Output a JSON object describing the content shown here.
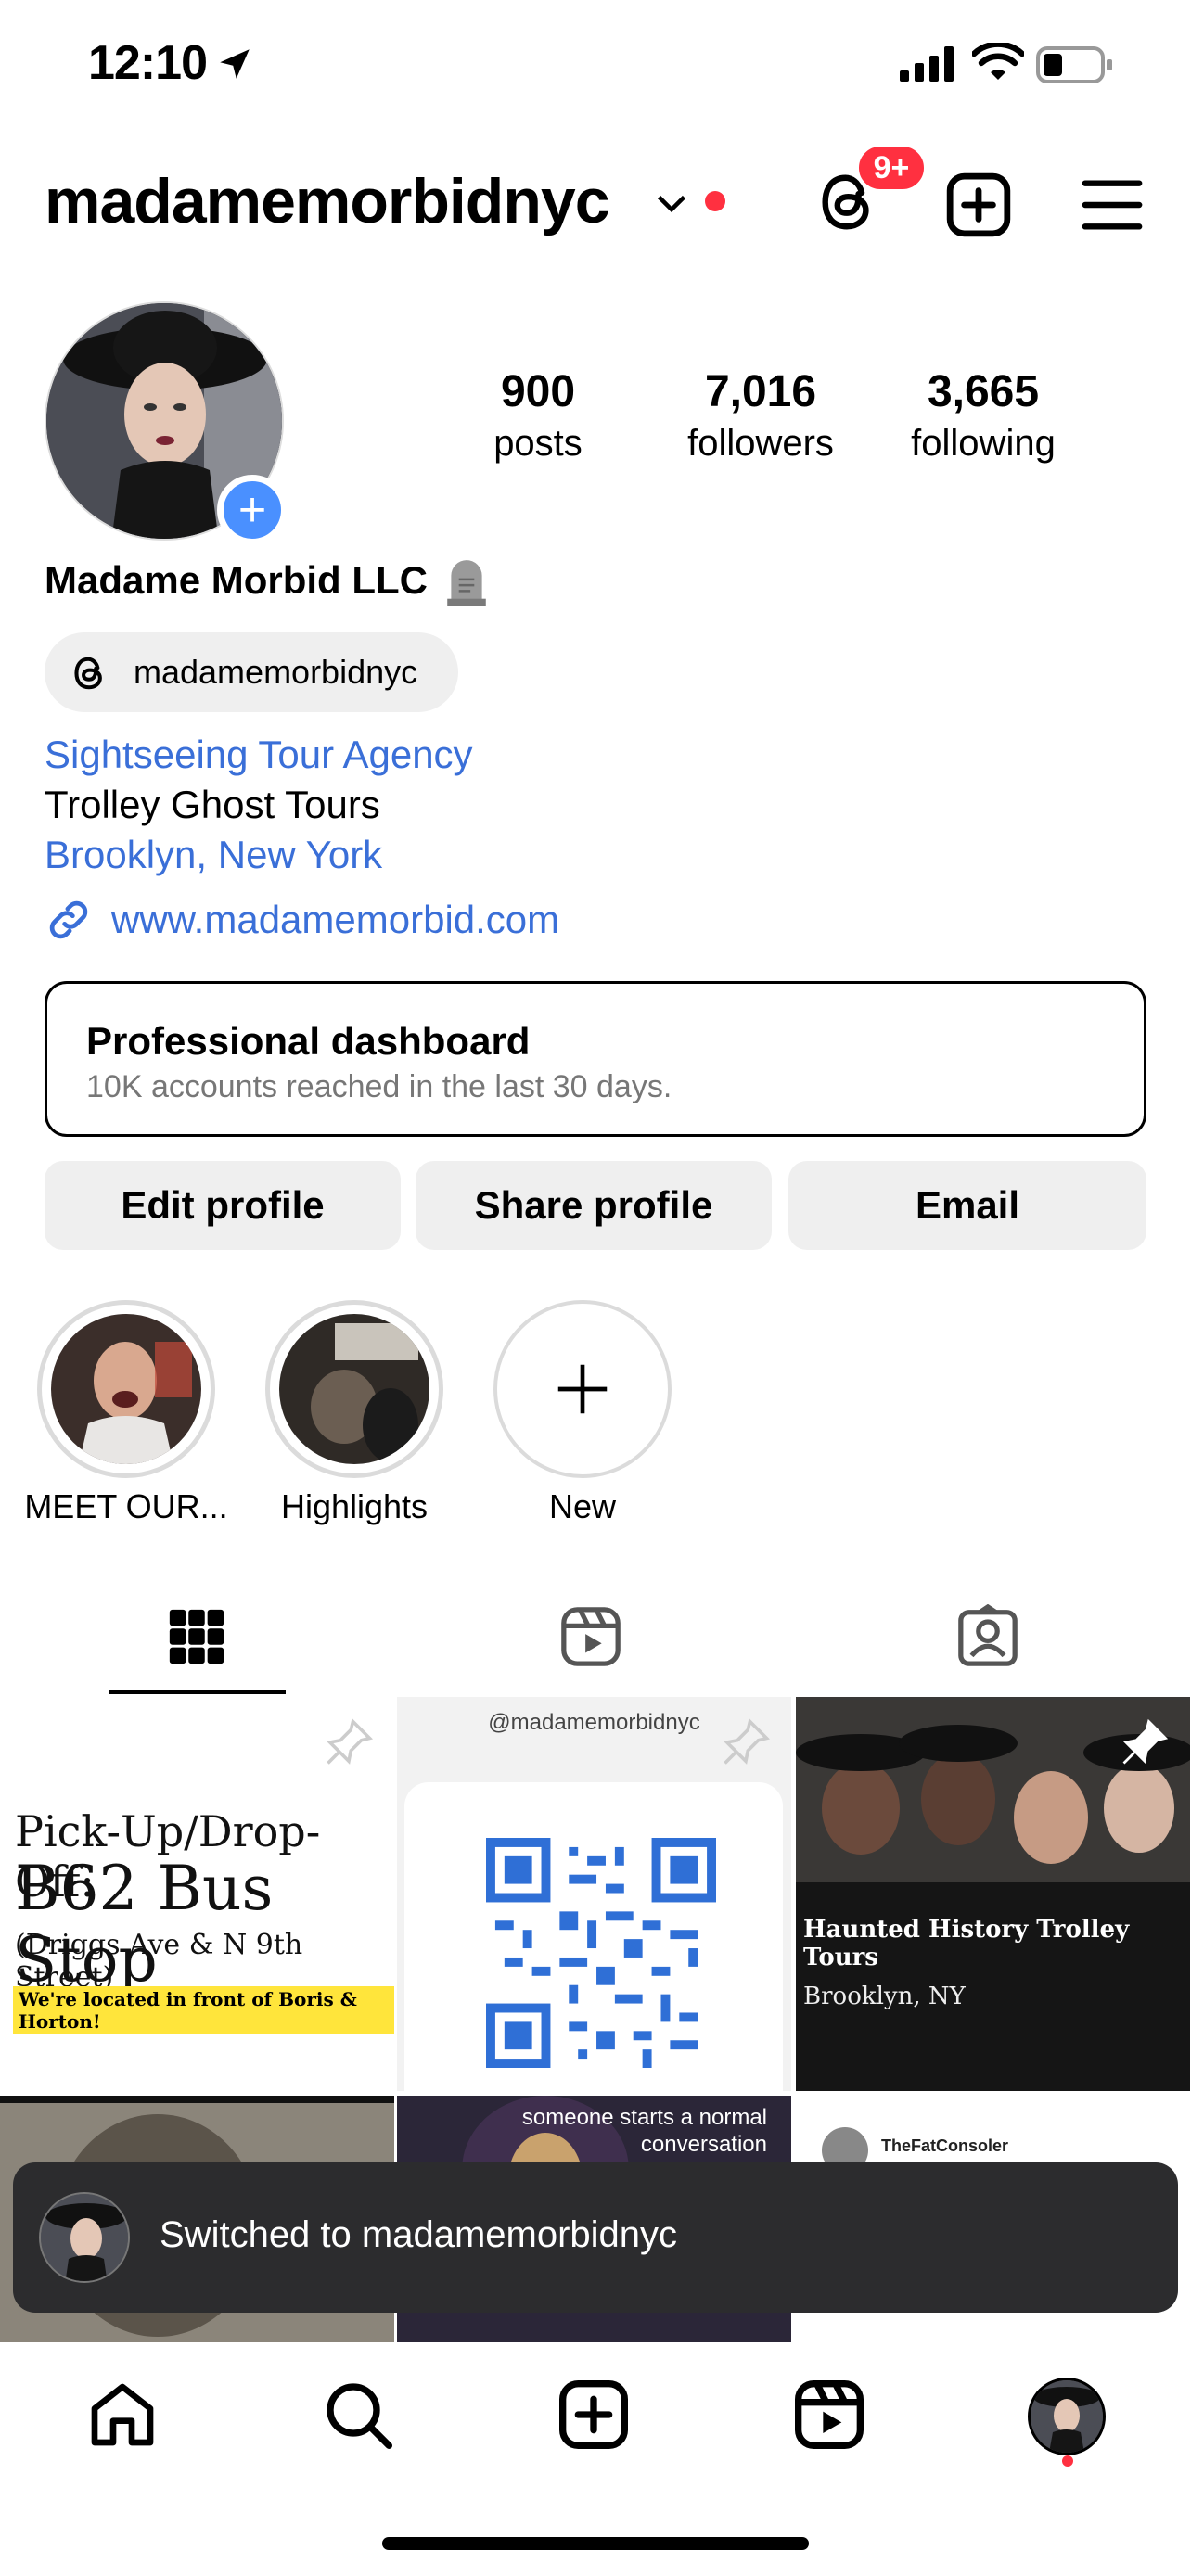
{
  "status_bar": {
    "time": "12:10"
  },
  "header": {
    "username": "madamemorbidnyc",
    "threads_badge": "9+"
  },
  "profile": {
    "stats": {
      "posts": {
        "value": "900",
        "label": "posts"
      },
      "followers": {
        "value": "7,016",
        "label": "followers"
      },
      "following": {
        "value": "3,665",
        "label": "following"
      }
    },
    "full_name": "Madame Morbid LLC",
    "threads_handle": "madamemorbidnyc",
    "category": "Sightseeing Tour Agency",
    "bio_line": "Trolley Ghost Tours",
    "location": "Brooklyn, New York",
    "website": "www.madamemorbid.com"
  },
  "dashboard": {
    "title": "Professional dashboard",
    "subtitle": "10K accounts reached in the last 30 days."
  },
  "actions": {
    "edit": "Edit profile",
    "share": "Share profile",
    "email": "Email"
  },
  "highlights": [
    {
      "label": "MEET OUR..."
    },
    {
      "label": "Highlights"
    },
    {
      "label": "New"
    }
  ],
  "posts": {
    "p1": {
      "title": "Pick-Up/Drop-Off:",
      "big": "B62 Bus Stop",
      "sub": "(Driggs Ave & N 9th Street)",
      "note": "We're located in front of Boris & Horton!"
    },
    "p2": {
      "handle": "@madamemorbidnyc"
    },
    "p3": {
      "title": "Haunted History Trolley Tours",
      "sub": "Brooklyn, NY"
    },
    "p5": {
      "text": "someone starts a normal conversation"
    },
    "p6": {
      "name": "TheFatConsoler"
    }
  },
  "toast": {
    "text": "Switched to madamemorbidnyc"
  },
  "colors": {
    "accent_blue": "#3a6fd8",
    "notification_red": "#ff3040",
    "button_gray": "#efefef"
  }
}
